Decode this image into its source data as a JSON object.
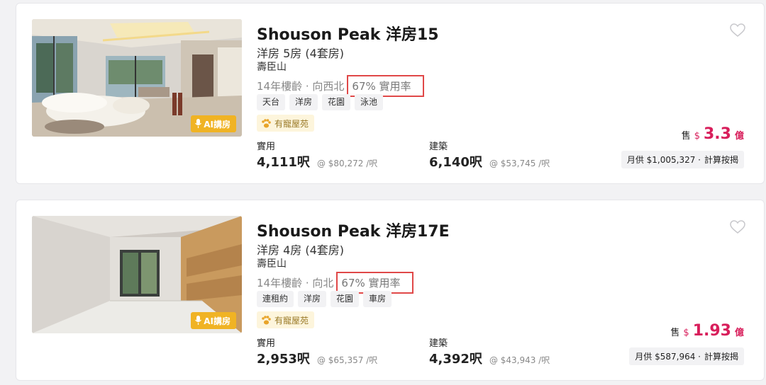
{
  "listings": [
    {
      "title": "Shouson Peak 洋房15",
      "subtitle": "洋房 5房 (4套房)",
      "district": "壽臣山",
      "age_facing": "14年樓齡 · 向西北",
      "efficiency": "67% 實用率",
      "tags": [
        "天台",
        "洋房",
        "花園",
        "泳池"
      ],
      "pet_label": "有寵屋苑",
      "ai_badge": "AI講房",
      "saleable_label": "實用",
      "saleable_area": "4,111呎",
      "saleable_unit_price": "@ $80,272 /呎",
      "gross_label": "建築",
      "gross_area": "6,140呎",
      "gross_unit_price": "@ $53,745 /呎",
      "price_sale_label": "售",
      "price_currency": "$",
      "price_value": "3.3",
      "price_unit": "億",
      "mortgage_text": "月供 $1,005,327 ·",
      "mortgage_calc": "計算按揭"
    },
    {
      "title": "Shouson Peak 洋房17E",
      "subtitle": "洋房 4房 (4套房)",
      "district": "壽臣山",
      "age_facing": "14年樓齡 · 向北",
      "efficiency": "67% 實用率",
      "tags": [
        "連租約",
        "洋房",
        "花園",
        "車房"
      ],
      "pet_label": "有寵屋苑",
      "ai_badge": "AI講房",
      "saleable_label": "實用",
      "saleable_area": "2,953呎",
      "saleable_unit_price": "@ $65,357 /呎",
      "gross_label": "建築",
      "gross_area": "4,392呎",
      "gross_unit_price": "@ $43,943 /呎",
      "price_sale_label": "售",
      "price_currency": "$",
      "price_value": "1.93",
      "price_unit": "億",
      "mortgage_text": "月供 $587,964 ·",
      "mortgage_calc": "計算按揭"
    }
  ],
  "colors": {
    "price": "#d81e5b",
    "highlight_box": "#e04848",
    "ai_badge": "#f0b324",
    "pet_bg": "#fdf5dc"
  },
  "icons": {
    "favorite": "heart-outline-icon",
    "ai": "microphone-icon",
    "pet": "paw-icon"
  }
}
